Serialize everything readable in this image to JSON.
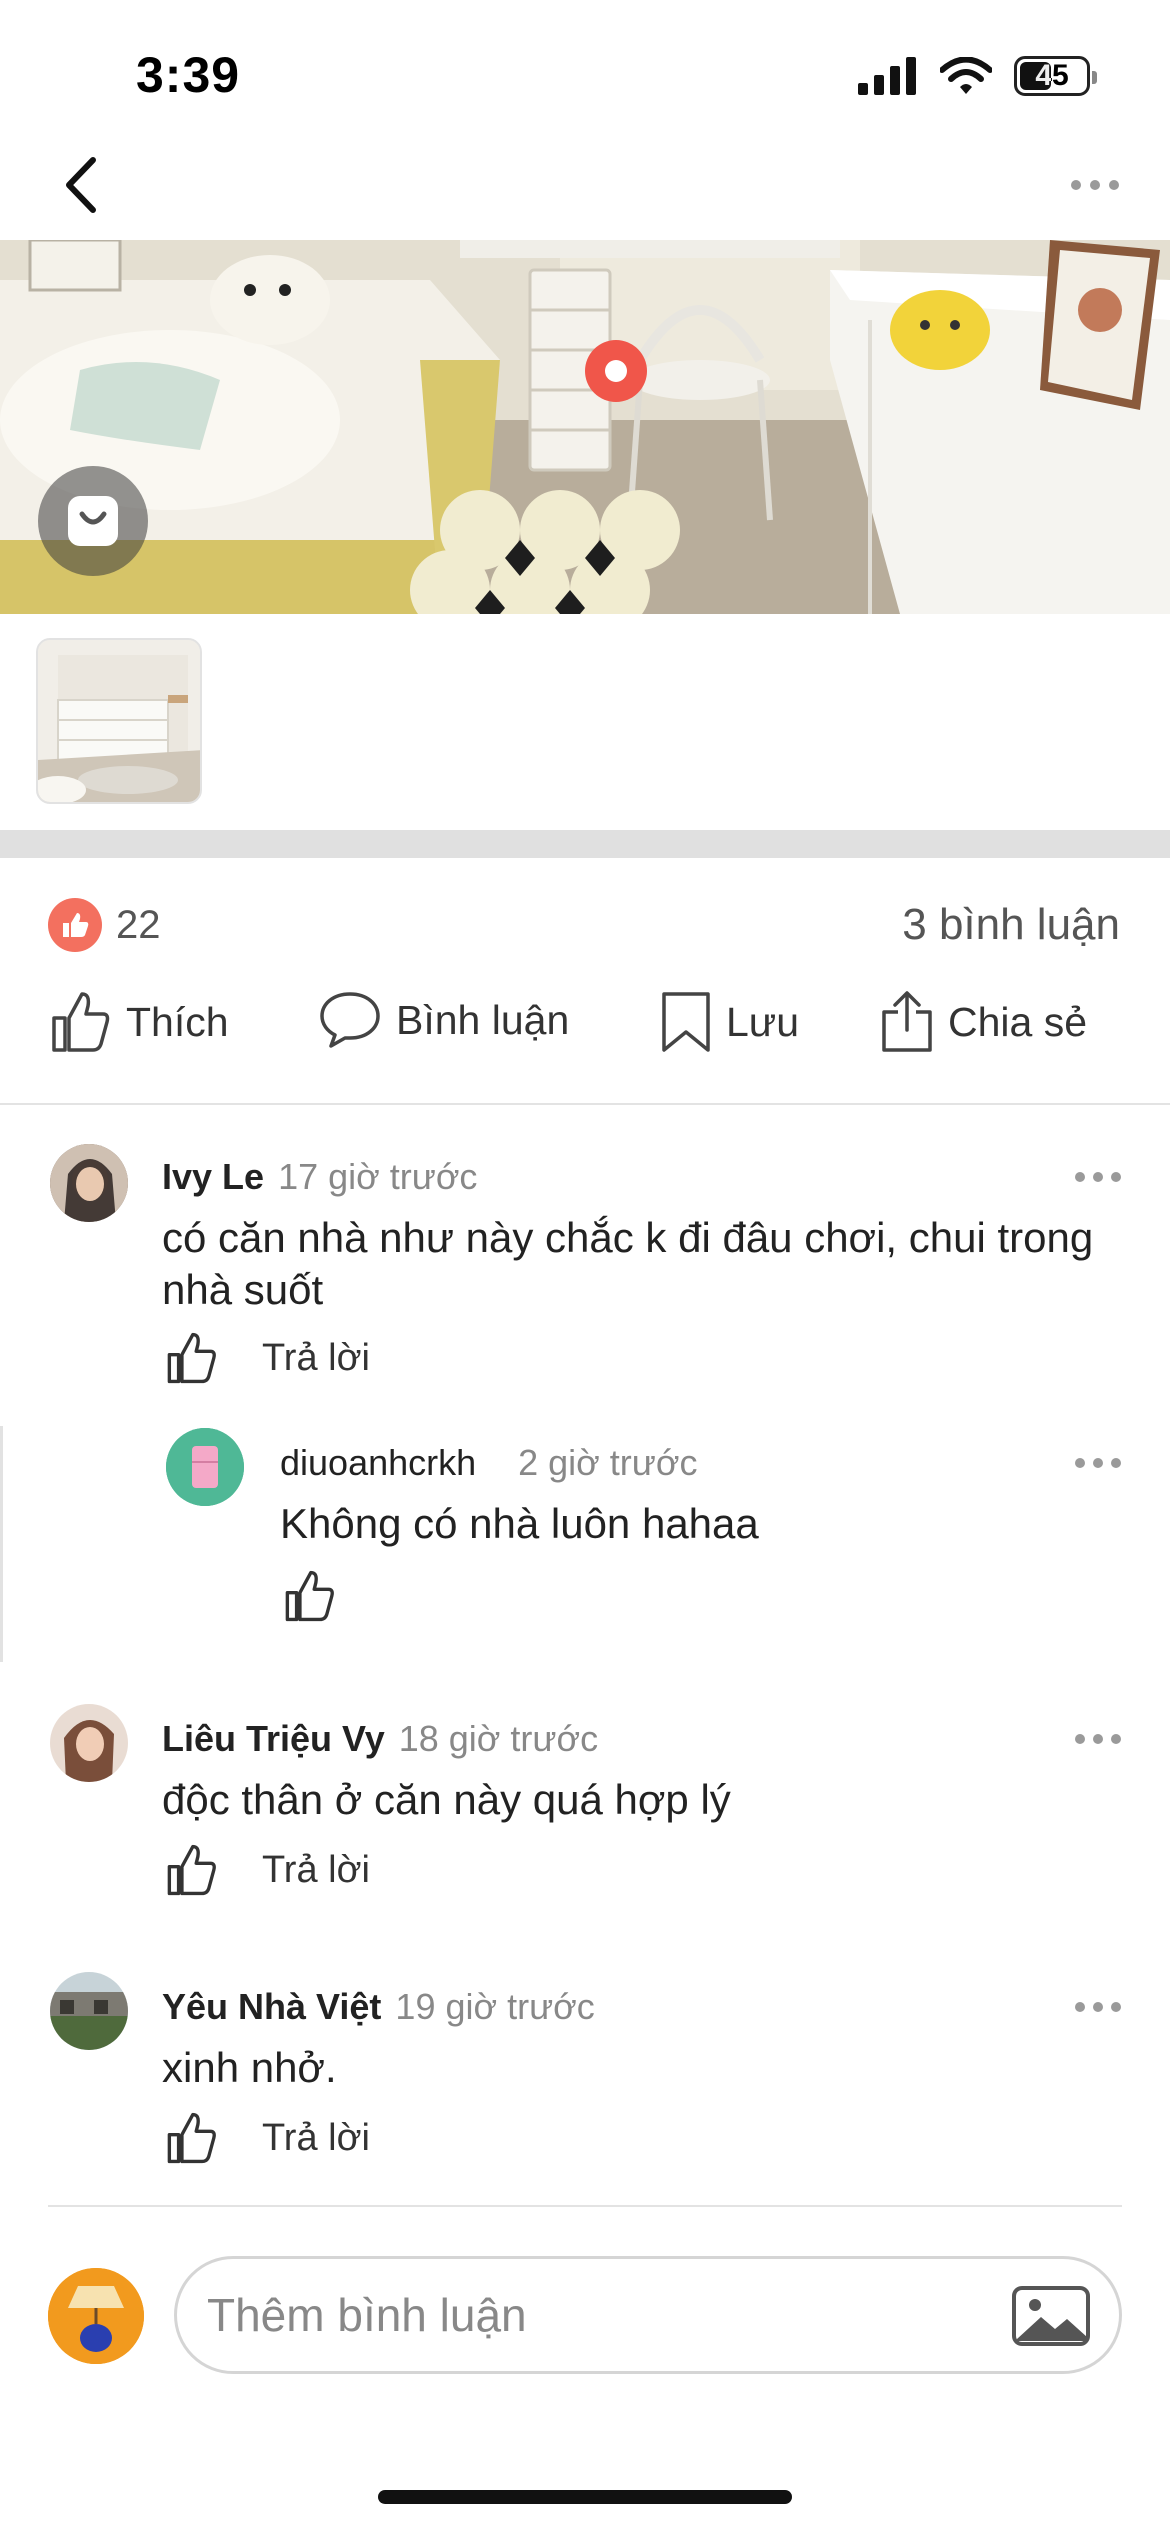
{
  "status_bar": {
    "time": "3:39",
    "battery": "45"
  },
  "post": {
    "like_count": "22",
    "comment_count": "3 bình luận"
  },
  "actions": {
    "like": "Thích",
    "comment": "Bình luận",
    "save": "Lưu",
    "share": "Chia sẻ"
  },
  "comments": [
    {
      "name": "Ivy Le",
      "time": "17 giờ trước",
      "text": "có căn nhà như này chắc k đi đâu chơi, chui trong nhà suốt",
      "reply_label": "Trả lời",
      "replies": [
        {
          "name": "diuoanhcrkh",
          "time": "2 giờ trước",
          "text": "Không có nhà luôn hahaa"
        }
      ]
    },
    {
      "name": "Liêu Triệu Vy",
      "time": "18 giờ trước",
      "text": "độc thân ở căn này quá hợp lý",
      "reply_label": "Trả lời"
    },
    {
      "name": "Yêu Nhà Việt",
      "time": "19 giờ trước",
      "text": "xinh nhở.",
      "reply_label": "Trả lời"
    }
  ],
  "composer": {
    "placeholder": "Thêm bình luận"
  },
  "icons": {
    "back": "chevron-left-icon",
    "more": "more-horizontal-icon",
    "shop": "shopping-bag-icon",
    "like": "thumbs-up-icon",
    "comment": "speech-bubble-icon",
    "save": "bookmark-icon",
    "share": "share-icon",
    "image": "image-icon"
  },
  "colors": {
    "accent": "#f0564a",
    "like_badge": "#f3705f",
    "avatar_me": "#f29a1e"
  }
}
